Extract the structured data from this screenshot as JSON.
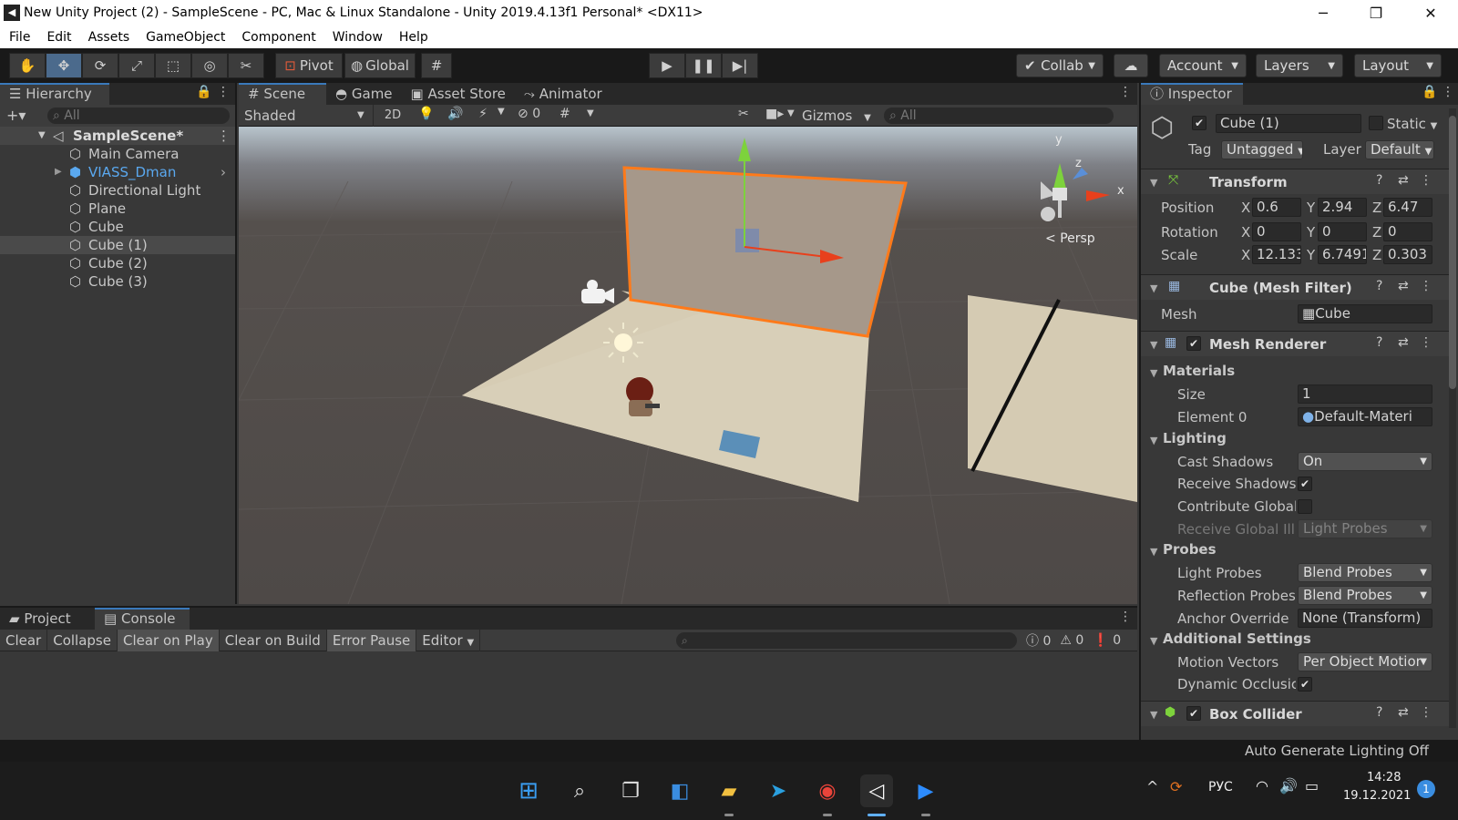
{
  "window": {
    "title": "New Unity Project (2) - SampleScene - PC, Mac & Linux Standalone - Unity 2019.4.13f1 Personal* <DX11>",
    "controls": [
      "─",
      "❐",
      "✕"
    ]
  },
  "menu": [
    "File",
    "Edit",
    "Assets",
    "GameObject",
    "Component",
    "Window",
    "Help"
  ],
  "toolbar": {
    "pivot_label": "Pivot",
    "global_label": "Global",
    "collab_label": "Collab",
    "account_label": "Account",
    "layers_label": "Layers",
    "layout_label": "Layout"
  },
  "hierarchy": {
    "tab_label": "Hierarchy",
    "search_placeholder": "All",
    "scene_name": "SampleScene*",
    "items": [
      {
        "label": "Main Camera"
      },
      {
        "label": "VIASS_Dman"
      },
      {
        "label": "Directional Light"
      },
      {
        "label": "Plane"
      },
      {
        "label": "Cube"
      },
      {
        "label": "Cube (1)"
      },
      {
        "label": "Cube (2)"
      },
      {
        "label": "Cube (3)"
      }
    ]
  },
  "scene": {
    "tabs": [
      "Scene",
      "Game",
      "Asset Store",
      "Animator"
    ],
    "shading_mode": "Shaded",
    "mode_2d": "2D",
    "hidden_count": "0",
    "gizmos_label": "Gizmos",
    "search_placeholder": "All",
    "persp_label": "Persp",
    "axis_y": "y",
    "axis_z": "z",
    "axis_x": "x"
  },
  "console": {
    "tabs": [
      "Project",
      "Console"
    ],
    "buttons": [
      "Clear",
      "Collapse",
      "Clear on Play",
      "Clear on Build",
      "Error Pause"
    ],
    "editor_label": "Editor",
    "info_count": "0",
    "warning_count": "0",
    "error_count": "0"
  },
  "inspector": {
    "tab_label": "Inspector",
    "object_name": "Cube (1)",
    "static_label": "Static",
    "tag_label": "Tag",
    "tag_value": "Untagged",
    "layer_label": "Layer",
    "layer_value": "Default",
    "transform": {
      "title": "Transform",
      "position_label": "Position",
      "rotation_label": "Rotation",
      "scale_label": "Scale",
      "position": {
        "x": "0.6",
        "y": "2.94",
        "z": "6.47"
      },
      "rotation": {
        "x": "0",
        "y": "0",
        "z": "0"
      },
      "scale": {
        "x": "12.133",
        "y": "6.7491",
        "z": "0.303"
      },
      "axis_x": "X",
      "axis_y": "Y",
      "axis_z": "Z"
    },
    "mesh_filter": {
      "title": "Cube (Mesh Filter)",
      "mesh_label": "Mesh",
      "mesh_value": "Cube"
    },
    "mesh_renderer": {
      "title": "Mesh Renderer",
      "materials_label": "Materials",
      "size_label": "Size",
      "size_value": "1",
      "element0_label": "Element 0",
      "element0_value": "Default-Materi",
      "lighting_label": "Lighting",
      "cast_shadows_label": "Cast Shadows",
      "cast_shadows_value": "On",
      "receive_shadows_label": "Receive Shadows",
      "contribute_gi_label": "Contribute Global",
      "receive_gi_label": "Receive Global Ill",
      "receive_gi_value": "Light Probes",
      "probes_label": "Probes",
      "light_probes_label": "Light Probes",
      "light_probes_value": "Blend Probes",
      "reflection_probes_label": "Reflection Probes",
      "reflection_probes_value": "Blend Probes",
      "anchor_override_label": "Anchor Override",
      "anchor_override_value": "None (Transform)",
      "additional_label": "Additional Settings",
      "motion_vectors_label": "Motion Vectors",
      "motion_vectors_value": "Per Object Motior",
      "dynamic_occlusion_label": "Dynamic Occlusic"
    },
    "box_collider": {
      "title": "Box Collider"
    }
  },
  "status": {
    "lighting": "Auto Generate Lighting Off"
  },
  "taskbar": {
    "lang": "РУС",
    "time": "14:28",
    "date": "19.12.2021",
    "notification_count": "1"
  },
  "colors": {
    "selection_orange": "#ff7a1a",
    "axis_green": "#7dd23c",
    "axis_red": "#e8401c",
    "unity_blue": "#3a79bb"
  }
}
